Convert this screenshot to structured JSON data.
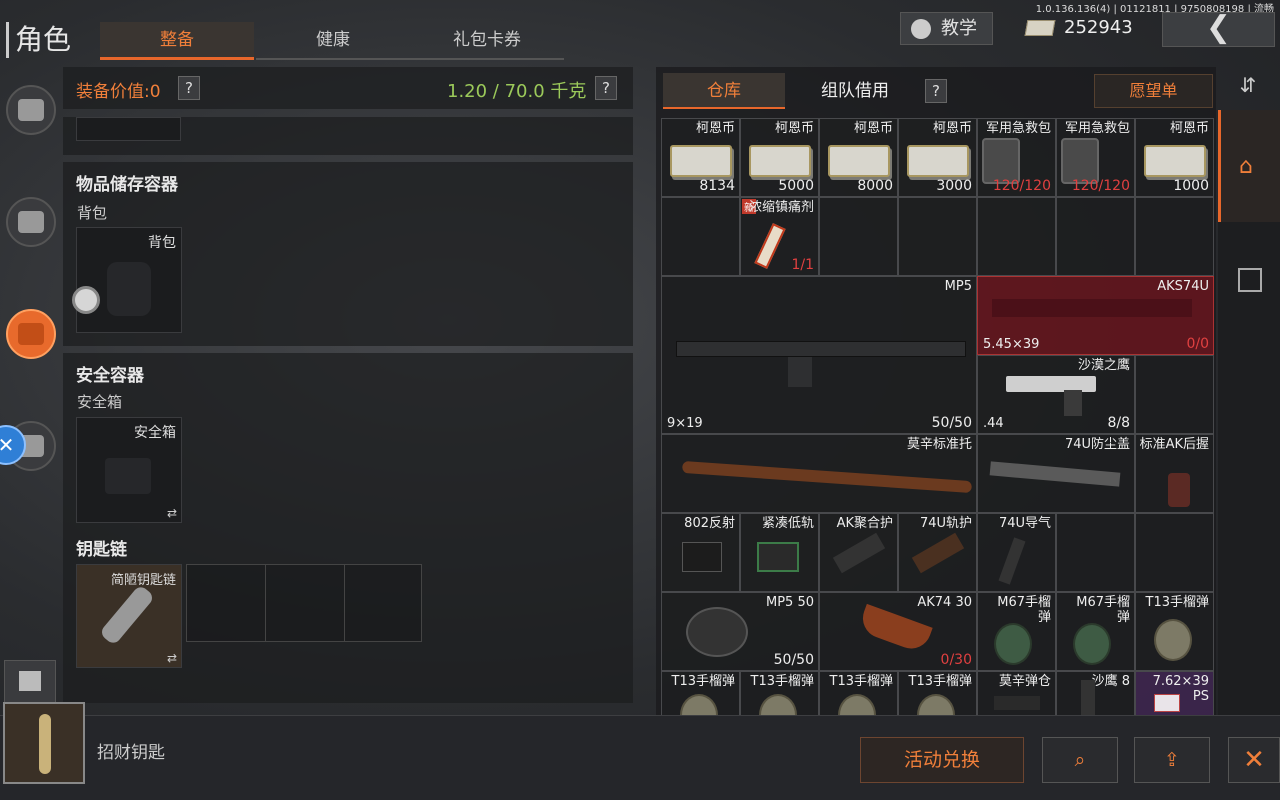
{
  "version": "1.0.136.136(4) | 01121811 | 9750808198 | 流畅",
  "header": {
    "title": "角色",
    "tabs": [
      {
        "label": "整备"
      },
      {
        "label": "健康"
      },
      {
        "label": "礼包卡券"
      }
    ],
    "tutorial_label": "教学",
    "currency_value": "252943"
  },
  "left": {
    "equip_value_label": "装备价值:0",
    "weight": "1.20 / 70.0 千克",
    "storage": {
      "title": "物品储存容器",
      "sub": "背包",
      "slot_label": "背包"
    },
    "safe": {
      "title": "安全容器",
      "sub": "安全箱",
      "slot_label": "安全箱"
    },
    "keychain": {
      "title": "钥匙链",
      "slot_label": "简陋钥匙链"
    }
  },
  "right": {
    "tabs": [
      {
        "label": "仓库"
      },
      {
        "label": "组队借用"
      }
    ],
    "wishlist": "愿望单"
  },
  "grid": {
    "items": [
      {
        "name": "柯恩币",
        "count": "8134",
        "icon": "cash-icon"
      },
      {
        "name": "柯恩币",
        "count": "5000",
        "icon": "cash-icon"
      },
      {
        "name": "柯恩币",
        "count": "8000",
        "icon": "cash-icon"
      },
      {
        "name": "柯恩币",
        "count": "3000",
        "icon": "cash-icon"
      },
      {
        "name": "军用急救包",
        "count": "120/120",
        "icon": "medkit-icon"
      },
      {
        "name": "军用急救包",
        "count": "120/120",
        "icon": "medkit-icon"
      },
      {
        "name": "柯恩币",
        "count": "1000",
        "icon": "cash-icon"
      },
      {
        "name": "浓缩镇痛剂",
        "count": "1/1",
        "badge": "新",
        "icon": "painkiller-icon"
      },
      {
        "name": "MP5",
        "caliber": "9×19",
        "count": "50/50",
        "icon": "smg-icon"
      },
      {
        "name": "AKS74U",
        "caliber": "5.45×39",
        "count": "0/0",
        "icon": "rifle-icon"
      },
      {
        "name": "沙漠之鹰",
        "caliber": ".44",
        "count": "8/8",
        "icon": "pistol-icon"
      },
      {
        "name": "莫辛标准托",
        "icon": "stock-icon"
      },
      {
        "name": "74U防尘盖",
        "icon": "dustcover-icon"
      },
      {
        "name": "标准AK后握",
        "icon": "grip-icon"
      },
      {
        "name": "802反射",
        "icon": "sight-icon"
      },
      {
        "name": "紧凑低轨",
        "icon": "rail-icon"
      },
      {
        "name": "AK聚合护",
        "icon": "handguard-icon"
      },
      {
        "name": "74U轨护",
        "icon": "handguard-icon"
      },
      {
        "name": "74U导气",
        "icon": "gastube-icon"
      },
      {
        "name": "MP5 50",
        "count": "50/50",
        "icon": "drum-mag-icon"
      },
      {
        "name": "AK74 30",
        "count": "0/30",
        "icon": "magazine-icon"
      },
      {
        "name": "M67手榴弹",
        "icon": "grenade-icon"
      },
      {
        "name": "M67手榴弹",
        "icon": "grenade-icon"
      },
      {
        "name": "T13手榴弹",
        "icon": "grenade-icon"
      },
      {
        "name": "T13手榴弹",
        "icon": "grenade-icon"
      },
      {
        "name": "T13手榴弹",
        "icon": "grenade-icon"
      },
      {
        "name": "T13手榴弹",
        "icon": "grenade-icon"
      },
      {
        "name": "T13手榴弹",
        "icon": "grenade-icon"
      },
      {
        "name": "莫辛弹仓",
        "icon": "magazine-icon"
      },
      {
        "name": "沙鹰 8",
        "icon": "magazine-icon"
      },
      {
        "name": "7.62×39 PS",
        "icon": "ammo-icon"
      }
    ]
  },
  "bottom": {
    "key_name": "招财钥匙",
    "exchange_label": "活动兑换"
  },
  "colors": {
    "accent": "#e8672b",
    "weight": "#9bc95a",
    "alert": "#e04040"
  }
}
